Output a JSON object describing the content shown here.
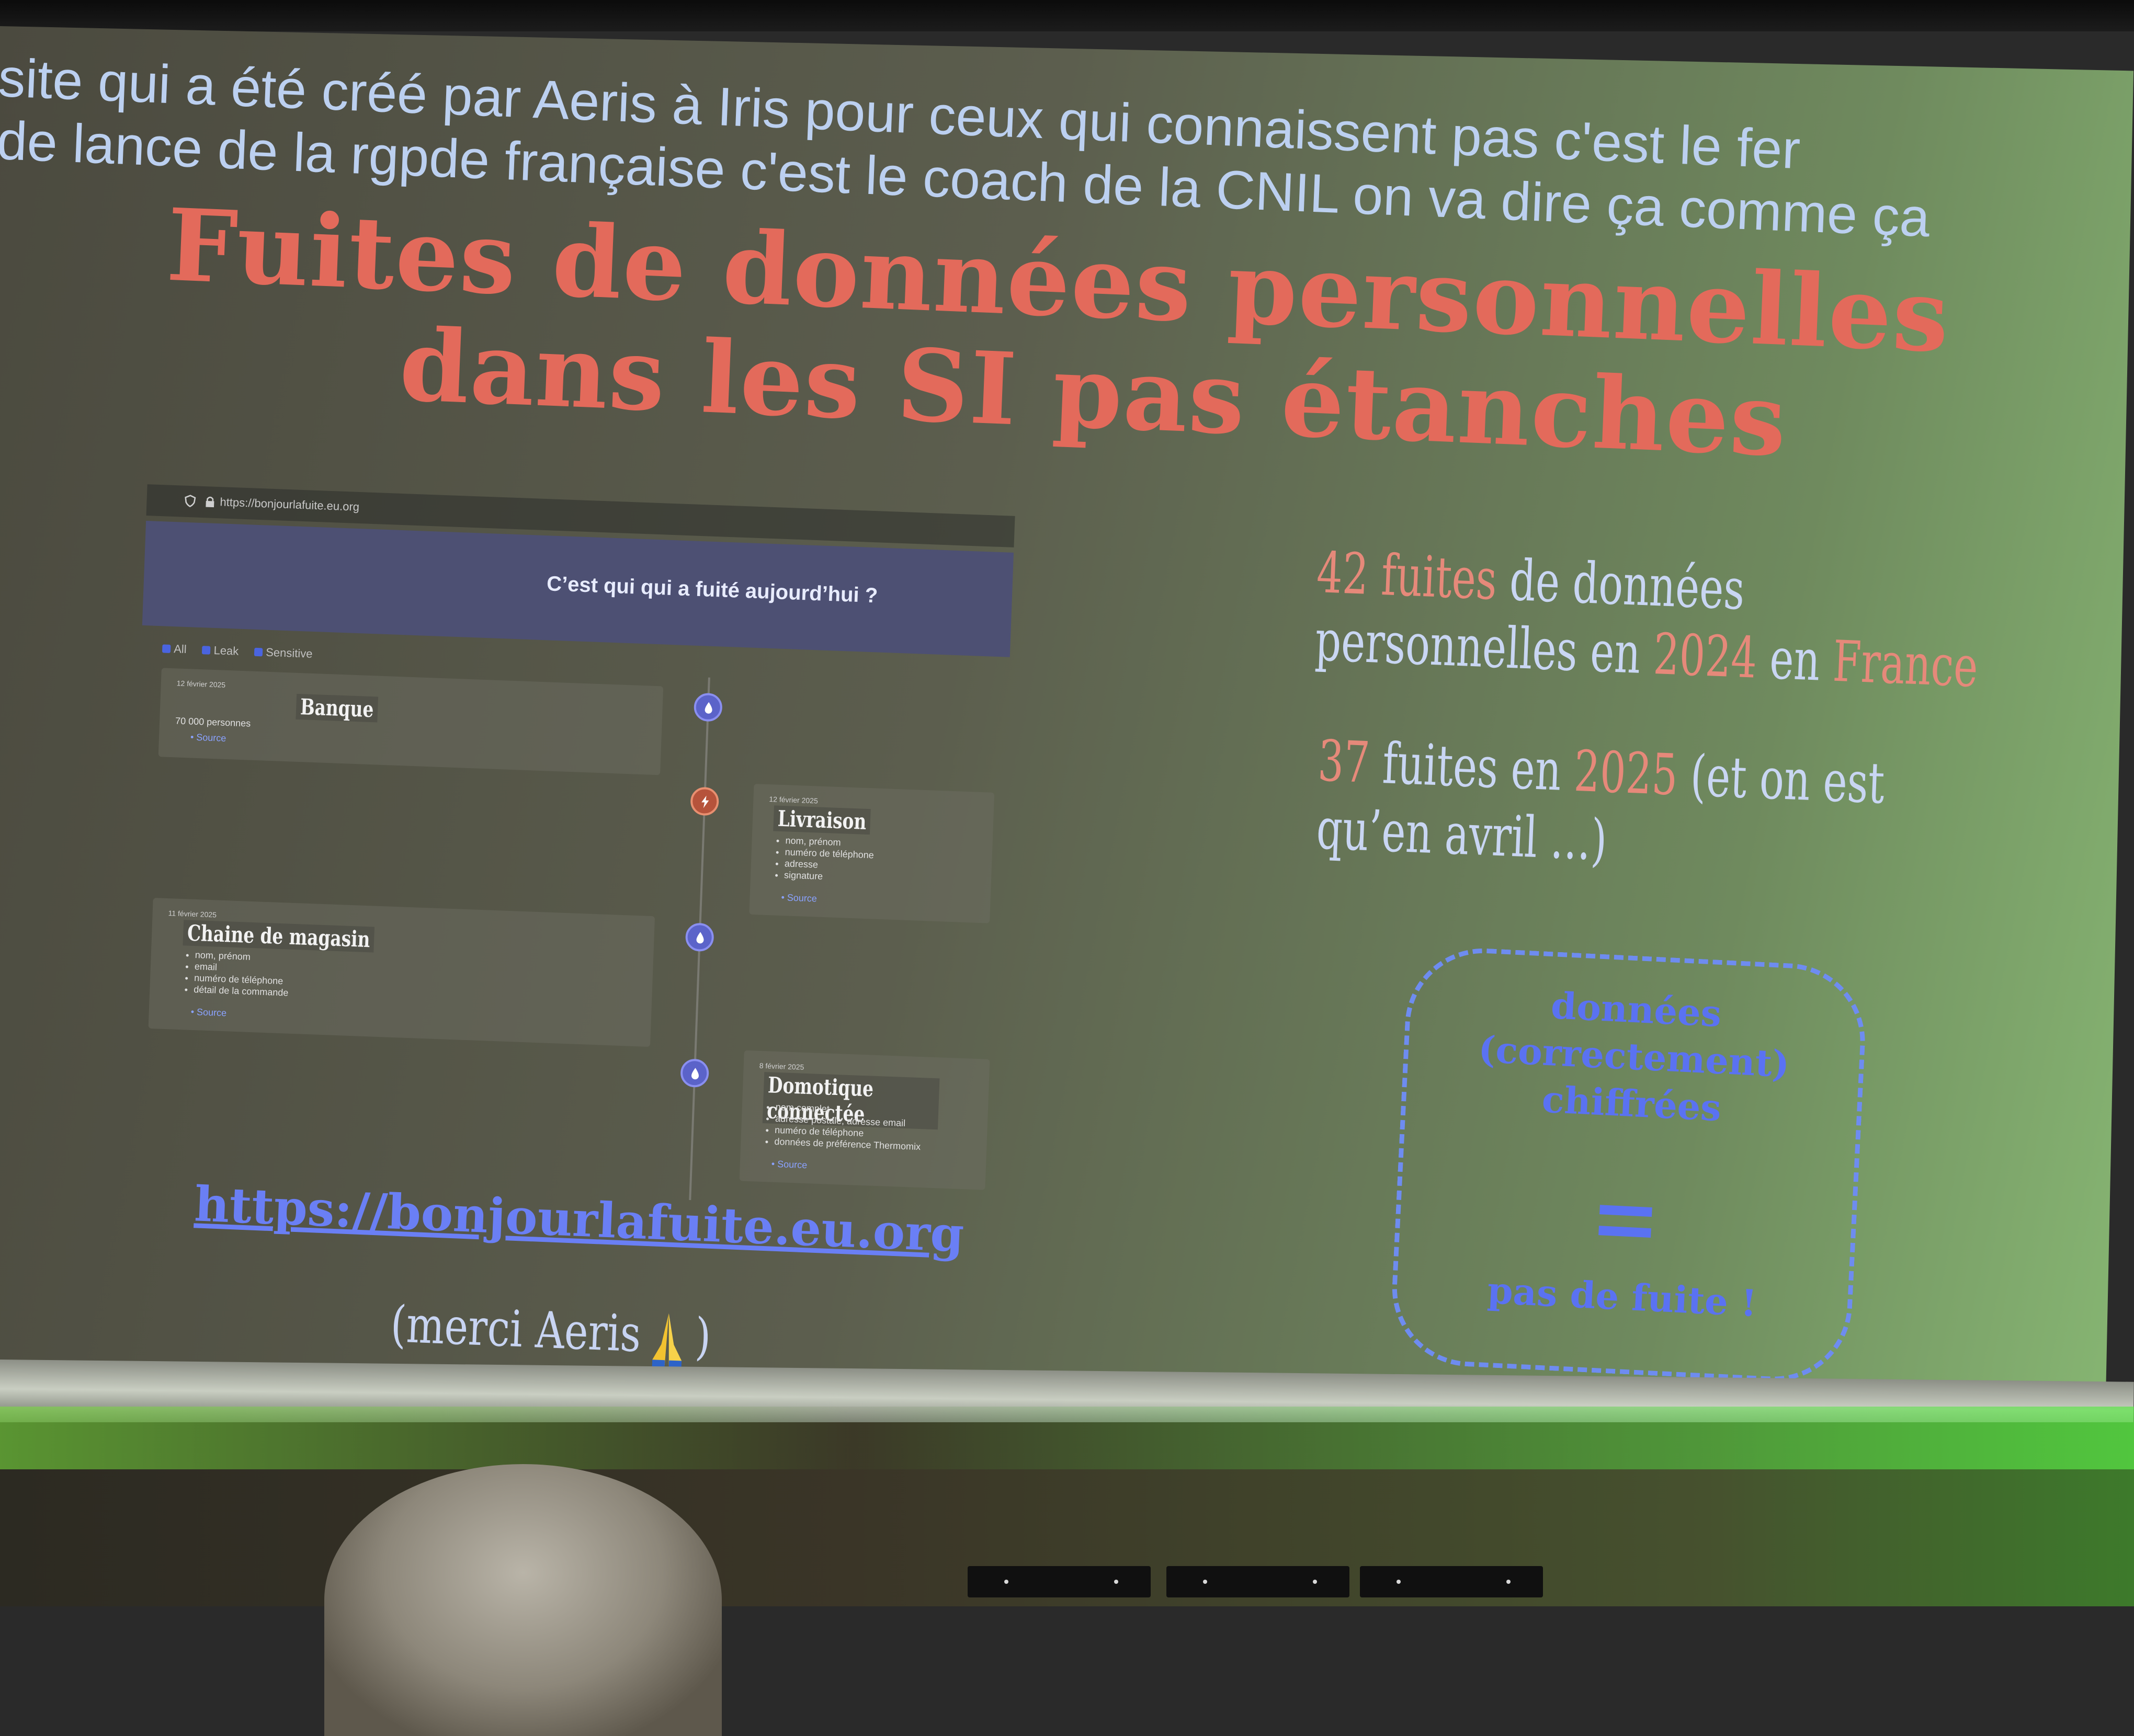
{
  "subtitles": {
    "line1": "site qui a été créé par Aeris à Iris pour ceux qui connaissent pas c'est le fer",
    "line2": "de lance de la rgpde française c'est le coach de la CNIL on va dire ça comme ça"
  },
  "slide": {
    "title_line1": "Fuites de données personnelles",
    "title_line2": "dans les SI pas étanches",
    "link": "https://bonjourlafuite.eu.org",
    "thanks_before": "(merci Aeris",
    "thanks_after": ")",
    "stats": {
      "s1_num": "42",
      "s1_a": "fuites",
      "s1_b": "de données",
      "s2_a": "personnelles en",
      "s2_year": "2024",
      "s2_b": "en",
      "s2_country": "France",
      "s3_num": "37",
      "s3_a": "fuites en",
      "s3_year": "2025",
      "s3_b": "(et on est",
      "s4": "qu’en avril …)"
    },
    "bubble": {
      "line1": "données",
      "line2": "(correctement)",
      "line3": "chiffrées",
      "line4": "pas de fuite !"
    }
  },
  "embedded_site": {
    "url": "https://bonjourlafuite.eu.org",
    "hero": "C’est qui qui a fuité aujourd’hui ?",
    "filters": [
      "All",
      "Leak",
      "Sensitive"
    ],
    "cards": [
      {
        "date": "12 février 2025",
        "name": "Banque",
        "count": "70 000 personnes",
        "items": [],
        "source": "Source"
      },
      {
        "date": "12 février 2025",
        "name": "Livraison",
        "items": [
          "nom, prénom",
          "numéro de téléphone",
          "adresse",
          "signature"
        ],
        "source": "Source"
      },
      {
        "date": "11 février 2025",
        "name": "Chaine de magasin",
        "items": [
          "nom, prénom",
          "email",
          "numéro de téléphone",
          "détail de la commande"
        ],
        "source": "Source"
      },
      {
        "date": "8 février 2025",
        "name": "Domotique connectée",
        "items": [
          "nom complet",
          "adresse postale, adresse email",
          "numéro de téléphone",
          "données de préférence Thermomix"
        ],
        "source": "Source"
      }
    ]
  },
  "colors": {
    "title": "#e36a5b",
    "subtitle": "#bcd0f0",
    "accent_blue": "#5a72f2",
    "highlight": "#e6897a"
  }
}
